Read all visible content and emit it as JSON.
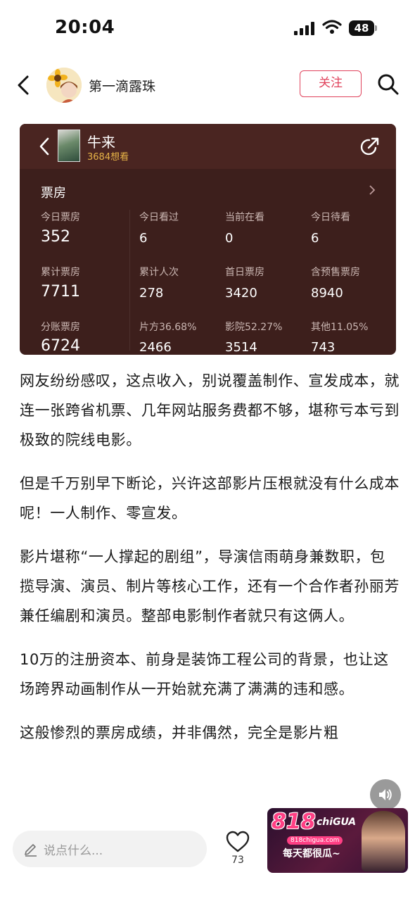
{
  "status_bar": {
    "time": "20:04",
    "battery": "48"
  },
  "header": {
    "author_name": "第一滴露珠",
    "follow_label": "关注"
  },
  "movie_card": {
    "title": "牛来",
    "want_count": "3684想看",
    "section_label": "票房",
    "stats": [
      {
        "label": "今日票房",
        "value": "352"
      },
      {
        "label": "今日看过",
        "value": "6"
      },
      {
        "label": "当前在看",
        "value": "0"
      },
      {
        "label": "今日待看",
        "value": "6"
      },
      {
        "label": "累计票房",
        "value": "7711"
      },
      {
        "label": "累计人次",
        "value": "278"
      },
      {
        "label": "首日票房",
        "value": "3420"
      },
      {
        "label": "含预售票房",
        "value": "8940"
      },
      {
        "label": "分账票房",
        "value": "6724"
      },
      {
        "label": "片方36.68%",
        "value": "2466"
      },
      {
        "label": "影院52.27%",
        "value": "3514"
      },
      {
        "label": "其他11.05%",
        "value": "743"
      }
    ]
  },
  "article": {
    "paragraphs": [
      "网友纷纷感叹，这点收入，别说覆盖制作、宣发成本，就连一张跨省机票、几年网站服务费都不够，堪称亏本亏到极致的院线电影。",
      "但是千万别早下断论，兴许这部影片压根就没有什么成本呢！一人制作、零宣发。",
      "影片堪称“一人撑起的剧组”，导演信雨萌身兼数职，包揽导演、演员、制片等核心工作，还有一个合作者孙丽芳兼任编剧和演员。整部电影制作者就只有这俩人。",
      "10万的注册资本、前身是装饰工程公司的背景，也让这场跨界动画制作从一开始就充满了满满的违和感。",
      "这般惨烈的票房成绩，并非偶然，完全是影片粗"
    ]
  },
  "bottom_bar": {
    "comment_placeholder": "说点什么...",
    "like_count": "73"
  },
  "ad": {
    "logo": "818",
    "logo_sub": "chiGUA",
    "url": "818chigua.com",
    "slogan": "每天都很瓜~"
  }
}
